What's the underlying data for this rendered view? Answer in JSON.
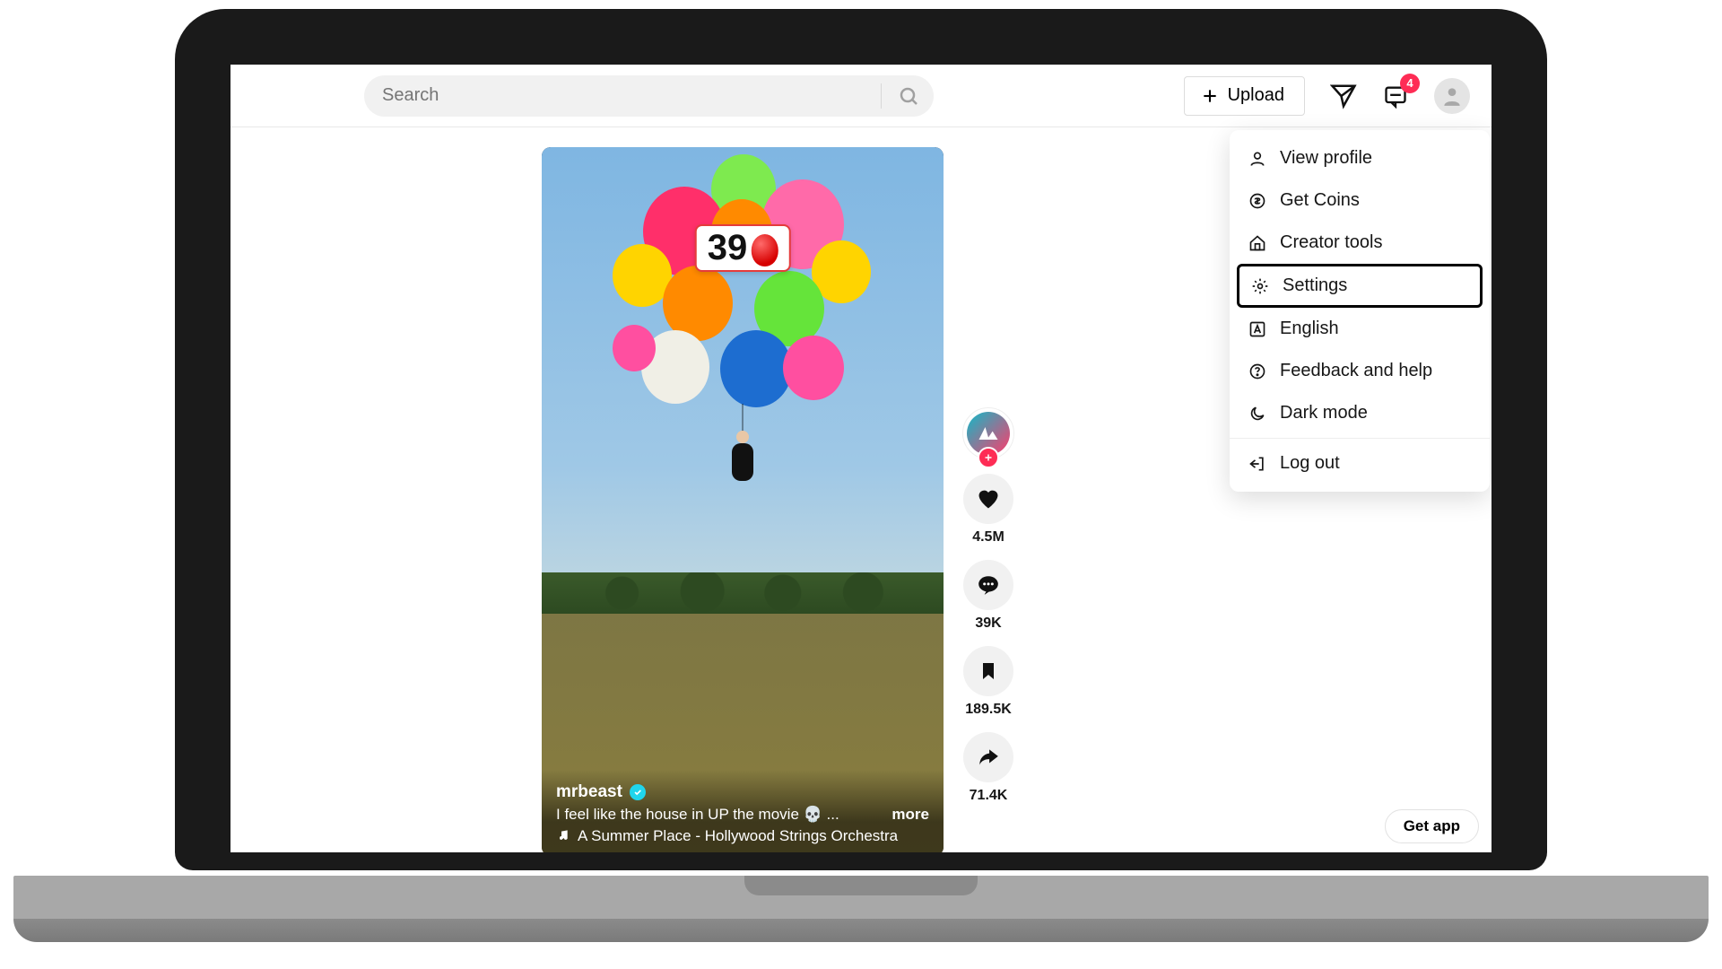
{
  "search": {
    "placeholder": "Search"
  },
  "header": {
    "upload_label": "Upload",
    "inbox_badge": "4"
  },
  "video": {
    "overlay_count": "39",
    "author": "mrbeast",
    "caption": "I feel like the house in UP the movie 💀 ...",
    "more_label": "more",
    "music": "A Summer Place - Hollywood Strings Orchestra"
  },
  "rail": {
    "like_count": "4.5M",
    "comment_count": "39K",
    "bookmark_count": "189.5K",
    "share_count": "71.4K"
  },
  "dropdown": {
    "view_profile": "View profile",
    "get_coins": "Get Coins",
    "creator_tools": "Creator tools",
    "settings": "Settings",
    "language": "English",
    "feedback": "Feedback and help",
    "dark_mode": "Dark mode",
    "log_out": "Log out"
  },
  "get_app_label": "Get app"
}
